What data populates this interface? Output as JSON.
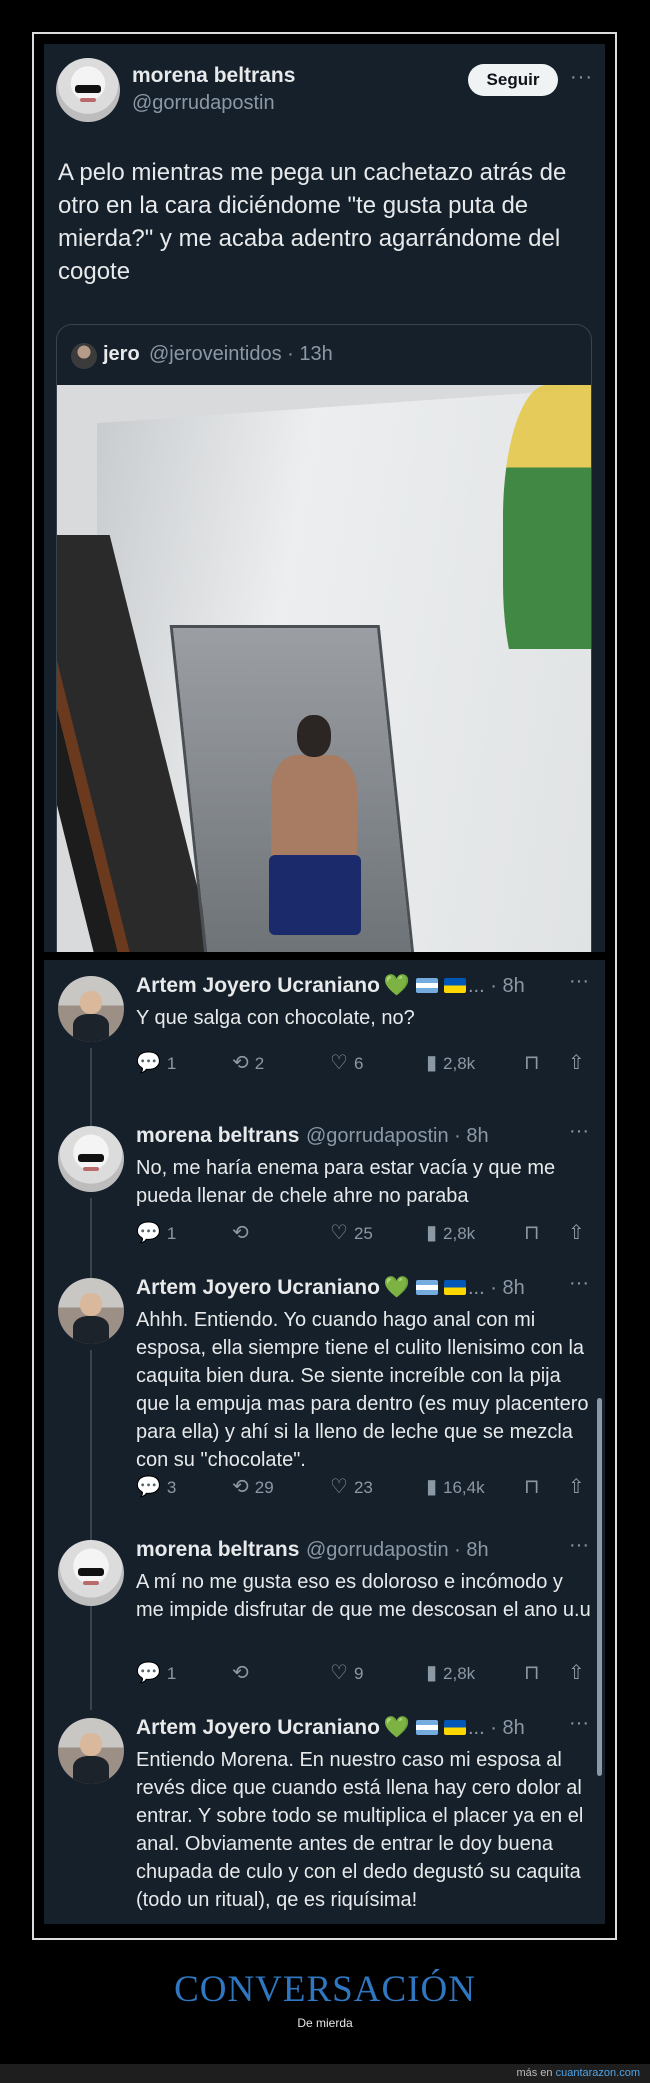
{
  "main_tweet": {
    "name": "morena beltrans",
    "handle": "@gorrudapostin",
    "follow_label": "Seguir",
    "more": "···",
    "text": "A pelo mientras me pega un cachetazo atrás de otro en la cara diciéndome \"te gusta puta de mierda?\" y me acaba adentro agarrándome del cogote",
    "quote": {
      "name": "jero",
      "handle_time": "@jeroveintidos · 13h"
    }
  },
  "replies": [
    {
      "name": "Artem Joyero Ucraniano",
      "handle": "... · 8h",
      "text": "Y que salga con chocolate, no?",
      "replies": "1",
      "retweets": "2",
      "likes": "6",
      "views": "2,8k",
      "emoji": true
    },
    {
      "name": "morena beltrans",
      "handle": "@gorrudapostin · 8h",
      "text": "No, me haría enema para estar vacía y que me pueda llenar de chele ahre no paraba",
      "replies": "1",
      "retweets": "",
      "likes": "25",
      "views": "2,8k",
      "emoji": false
    },
    {
      "name": "Artem Joyero Ucraniano",
      "handle": "... · 8h",
      "text": "Ahhh. Entiendo. Yo cuando hago anal con mi esposa, ella siempre tiene el culito llenisimo con la caquita bien dura. Se siente increíble con la pija que la empuja mas para dentro (es muy placentero para ella) y ahí si la lleno de leche que se mezcla con su \"chocolate\".",
      "replies": "3",
      "retweets": "29",
      "likes": "23",
      "views": "16,4k",
      "emoji": true
    },
    {
      "name": "morena beltrans",
      "handle": "@gorrudapostin · 8h",
      "text": "A mí no me gusta eso es doloroso e incómodo y me impide disfrutar de que me descosan el ano u.u",
      "replies": "1",
      "retweets": "",
      "likes": "9",
      "views": "2,8k",
      "emoji": false
    },
    {
      "name": "Artem Joyero Ucraniano",
      "handle": "... · 8h",
      "text": "Entiendo Morena. En nuestro caso mi esposa al revés dice que cuando está llena hay cero dolor al entrar. Y sobre todo se multiplica el placer ya en el anal. Obviamente antes de entrar le doy buena chupada de culo y con el dedo degustó su caquita (todo un ritual), qe es riquísima!",
      "emoji": true
    }
  ],
  "icons": {
    "reply": "reply-icon",
    "retweet": "retweet-icon",
    "like": "heart-icon",
    "views": "views-icon",
    "bookmark": "bookmark-icon",
    "share": "share-icon"
  },
  "colors": {
    "background": "#15202b",
    "text": "#e7e9ea",
    "muted": "#8b98a5",
    "caption": "#2f77c0"
  },
  "caption": {
    "title": "CONVERSACIÓN",
    "subtitle": "De mierda"
  },
  "footer": {
    "prefix": "más en",
    "link": "cuantarazon.com"
  }
}
